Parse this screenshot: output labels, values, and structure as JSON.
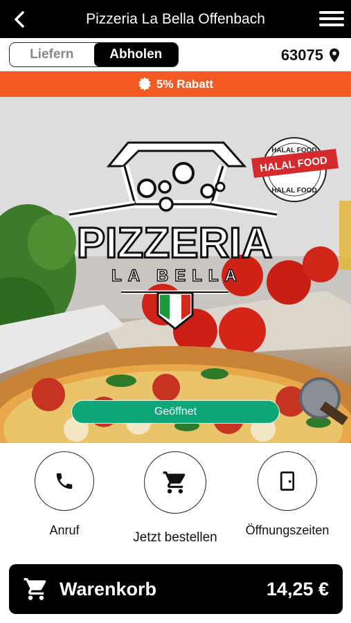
{
  "header": {
    "title": "Pizzeria La Bella Offenbach",
    "back_icon": "chevron-left-icon",
    "menu_icon": "hamburger-menu-icon"
  },
  "mode": {
    "options": [
      "Liefern",
      "Abholen"
    ],
    "selected": "Abholen"
  },
  "location": {
    "zip": "63075",
    "icon": "map-pin-icon"
  },
  "promo": {
    "text": "5% Rabatt",
    "icon": "badge-icon",
    "color": "#f55a22"
  },
  "hero": {
    "logo_text": {
      "line1": "PIZZERIA",
      "line2": "LA BELLA"
    },
    "halal_seal": {
      "top": "HALAL FOOD",
      "center": "HALAL FOOD",
      "bottom": "HALAL FOOD"
    },
    "status": "Geöffnet",
    "status_color": "#0fa77a"
  },
  "actions": [
    {
      "label": "Anruf",
      "icon": "phone-icon"
    },
    {
      "label": "Jetzt bestellen",
      "icon": "shopping-cart-icon"
    },
    {
      "label": "Öffnungszeiten",
      "icon": "door-icon"
    }
  ],
  "cart": {
    "label": "Warenkorb",
    "total": "14,25 €",
    "icon": "shopping-cart-icon"
  }
}
